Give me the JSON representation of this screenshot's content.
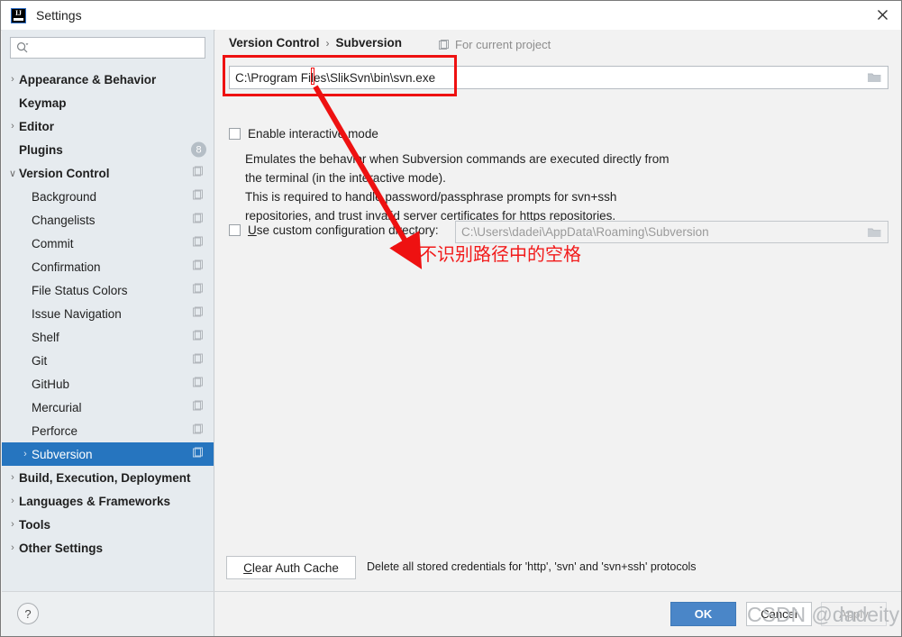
{
  "window": {
    "title": "Settings",
    "app_icon": "intellij-idea-icon",
    "close_icon": "close-icon"
  },
  "search": {
    "value": "",
    "placeholder": "",
    "icon": "search-icon"
  },
  "sidebar": {
    "items": [
      {
        "label": "Appearance & Behavior",
        "level": 0,
        "bold": true,
        "arrow": "›",
        "copy": false
      },
      {
        "label": "Keymap",
        "level": 0,
        "bold": true,
        "arrow": "",
        "copy": false
      },
      {
        "label": "Editor",
        "level": 0,
        "bold": true,
        "arrow": "›",
        "copy": false
      },
      {
        "label": "Plugins",
        "level": 0,
        "bold": true,
        "arrow": "",
        "copy": false,
        "badge": "8"
      },
      {
        "label": "Version Control",
        "level": 0,
        "bold": true,
        "arrow": "∨",
        "copy": true
      },
      {
        "label": "Background",
        "level": 1,
        "bold": false,
        "arrow": "",
        "copy": true
      },
      {
        "label": "Changelists",
        "level": 1,
        "bold": false,
        "arrow": "",
        "copy": true
      },
      {
        "label": "Commit",
        "level": 1,
        "bold": false,
        "arrow": "",
        "copy": true
      },
      {
        "label": "Confirmation",
        "level": 1,
        "bold": false,
        "arrow": "",
        "copy": true
      },
      {
        "label": "File Status Colors",
        "level": 1,
        "bold": false,
        "arrow": "",
        "copy": true
      },
      {
        "label": "Issue Navigation",
        "level": 1,
        "bold": false,
        "arrow": "",
        "copy": true
      },
      {
        "label": "Shelf",
        "level": 1,
        "bold": false,
        "arrow": "",
        "copy": true
      },
      {
        "label": "Git",
        "level": 1,
        "bold": false,
        "arrow": "",
        "copy": true
      },
      {
        "label": "GitHub",
        "level": 1,
        "bold": false,
        "arrow": "",
        "copy": true
      },
      {
        "label": "Mercurial",
        "level": 1,
        "bold": false,
        "arrow": "",
        "copy": true
      },
      {
        "label": "Perforce",
        "level": 1,
        "bold": false,
        "arrow": "",
        "copy": true
      },
      {
        "label": "Subversion",
        "level": 1,
        "bold": false,
        "arrow": "›",
        "copy": true,
        "selected": true
      },
      {
        "label": "Build, Execution, Deployment",
        "level": 0,
        "bold": true,
        "arrow": "›",
        "copy": false
      },
      {
        "label": "Languages & Frameworks",
        "level": 0,
        "bold": true,
        "arrow": "›",
        "copy": false
      },
      {
        "label": "Tools",
        "level": 0,
        "bold": true,
        "arrow": "›",
        "copy": false
      },
      {
        "label": "Other Settings",
        "level": 0,
        "bold": true,
        "arrow": "›",
        "copy": false
      }
    ]
  },
  "content": {
    "breadcrumb": {
      "root": "Version Control",
      "separator": "›",
      "leaf": "Subversion"
    },
    "scope_note": {
      "icon": "project-scope-icon",
      "label": "For current project"
    },
    "svn_path": {
      "value": "C:\\Program Files\\SlikSvn\\bin\\svn.exe",
      "browse_icon": "folder-browse-icon"
    },
    "interactive_mode": {
      "label": "Enable interactive mode",
      "checked": false
    },
    "description_lines": [
      "Emulates the behavior when Subversion commands are executed directly from",
      "the terminal (in the interactive mode).",
      "This is required to handle password/passphrase prompts for svn+ssh",
      "repositories, and trust invalid server certificates for https repositories."
    ],
    "custom_config": {
      "label_underlined": "U",
      "label_rest": "se custom configuration directory:",
      "checked": false,
      "value": "C:\\Users\\dadei\\AppData\\Roaming\\Subversion",
      "browse_icon": "folder-browse-icon"
    },
    "clear_auth": {
      "label_underlined": "C",
      "label_rest": "lear Auth Cache",
      "note": "Delete all stored credentials for 'http', 'svn' and 'svn+ssh' protocols"
    }
  },
  "footer": {
    "help_label": "?",
    "ok_label": "OK",
    "cancel_label": "Cancel",
    "apply_label": "Apply"
  },
  "annotation": {
    "text": "不识别路径中的空格",
    "color": "#f21b1b",
    "highlight_color": "#ee1111"
  },
  "watermark": {
    "text": "CSDN @dadeity"
  },
  "colors": {
    "accent": "#2675bf",
    "ok_button": "#4a86c8",
    "sidebar_bg": "#e6ebef",
    "content_bg": "#f2f2f2"
  }
}
